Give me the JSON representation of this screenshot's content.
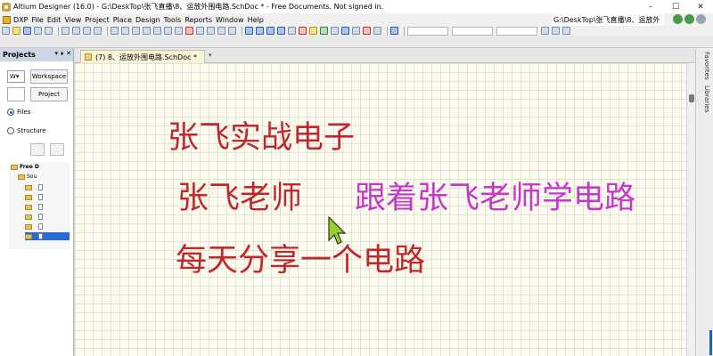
{
  "window": {
    "title": "Altium Designer (16.0) - G:\\DeskTop\\张飞直播\\8、运放外围电路.SchDoc * - Free Documents. Not signed in.",
    "controls": {
      "minimize": "–",
      "maximize": "☐",
      "close": "✕"
    }
  },
  "menu": {
    "items": [
      "DXP",
      "File",
      "Edit",
      "View",
      "Project",
      "Place",
      "Design",
      "Tools",
      "Reports",
      "Window",
      "Help"
    ],
    "path": "G:\\DeskTop\\张飞直播\\8、运放外"
  },
  "panel": {
    "title": "Projects",
    "header_icons": [
      "▾",
      "⬧",
      "✕"
    ],
    "workspace_select": "W▾",
    "workspace_button": "Workspace",
    "project_button": "Project",
    "radio_files": "Files",
    "radio_structure": "Structure",
    "tree": {
      "root": "Free D",
      "source": "Sou"
    }
  },
  "document_tab": {
    "label": "(7) 8、运放外围电路.SchDoc *",
    "menu_glyph": "▾"
  },
  "schematic": {
    "line1": "张飞实战电子",
    "line2_left": "张飞老师",
    "line2_right": "跟着张飞老师学电路",
    "line3": "每天分享一个电路"
  },
  "right_panels": {
    "favorites": "Favorites",
    "libraries": "Libraries"
  },
  "colors": {
    "red_text": "#c1272d",
    "magenta_text": "#c638c9",
    "cursor": "#9acd32",
    "selection": "#2a6ad8"
  }
}
